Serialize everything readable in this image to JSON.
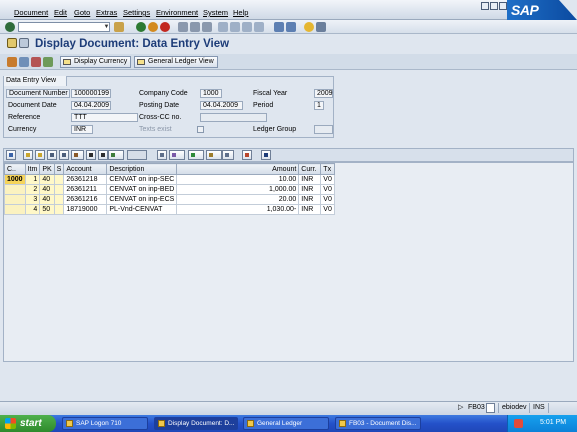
{
  "menu": {
    "items": [
      "Document",
      "Edit",
      "Goto",
      "Extras",
      "Settings",
      "Environment",
      "System",
      "Help"
    ]
  },
  "page": {
    "title": "Display Document: Data Entry View"
  },
  "app_toolbar": {
    "display_currency": "Display Currency",
    "general_ledger_view": "General Ledger View"
  },
  "entry_view": {
    "tab_label": "Data Entry View",
    "document_number_label": "Document Number",
    "document_number": "100000199",
    "company_code_label": "Company Code",
    "company_code": "1000",
    "fiscal_year_label": "Fiscal Year",
    "fiscal_year": "2009",
    "document_date_label": "Document Date",
    "document_date": "04.04.2009",
    "posting_date_label": "Posting Date",
    "posting_date": "04.04.2009",
    "period_label": "Period",
    "period": "1",
    "reference_label": "Reference",
    "reference": "TTT",
    "cross_cc_label": "Cross-CC no.",
    "cross_cc": "",
    "currency_label": "Currency",
    "currency": "INR",
    "texts_exist_label": "Texts exist",
    "ledger_group_label": "Ledger Group",
    "ledger_group": ""
  },
  "grid": {
    "columns": [
      "C..",
      "Itm",
      "PK",
      "S",
      "Account",
      "Description",
      "Amount",
      "Curr.",
      "Tx"
    ],
    "rows": [
      {
        "c": "1000",
        "itm": "1",
        "pk": "40",
        "s": "",
        "account": "26361218",
        "description": "CENVAT on inp-SEC",
        "amount": "10.00",
        "curr": "INR",
        "tx": "V0"
      },
      {
        "c": "",
        "itm": "2",
        "pk": "40",
        "s": "",
        "account": "26361211",
        "description": "CENVAT on inp-BED",
        "amount": "1,000.00",
        "curr": "INR",
        "tx": "V0"
      },
      {
        "c": "",
        "itm": "3",
        "pk": "40",
        "s": "",
        "account": "26361216",
        "description": "CENVAT on inp-ECS",
        "amount": "20.00",
        "curr": "INR",
        "tx": "V0"
      },
      {
        "c": "",
        "itm": "4",
        "pk": "50",
        "s": "",
        "account": "18719000",
        "description": "PL-Vnd-CENVAT",
        "amount": "1,030.00-",
        "curr": "INR",
        "tx": "V0"
      }
    ]
  },
  "status": {
    "transaction": "FB03",
    "user": "ebiodev",
    "mode": "INS"
  },
  "taskbar": {
    "start": "start",
    "tasks": [
      "SAP Logon 710",
      "Display Document: D...",
      "General Ledger",
      "FB03 - Document Dis..."
    ],
    "clock": "5:01 PM"
  },
  "brand": {
    "logo_text": "SAP",
    "accent": "#1d3c78"
  }
}
